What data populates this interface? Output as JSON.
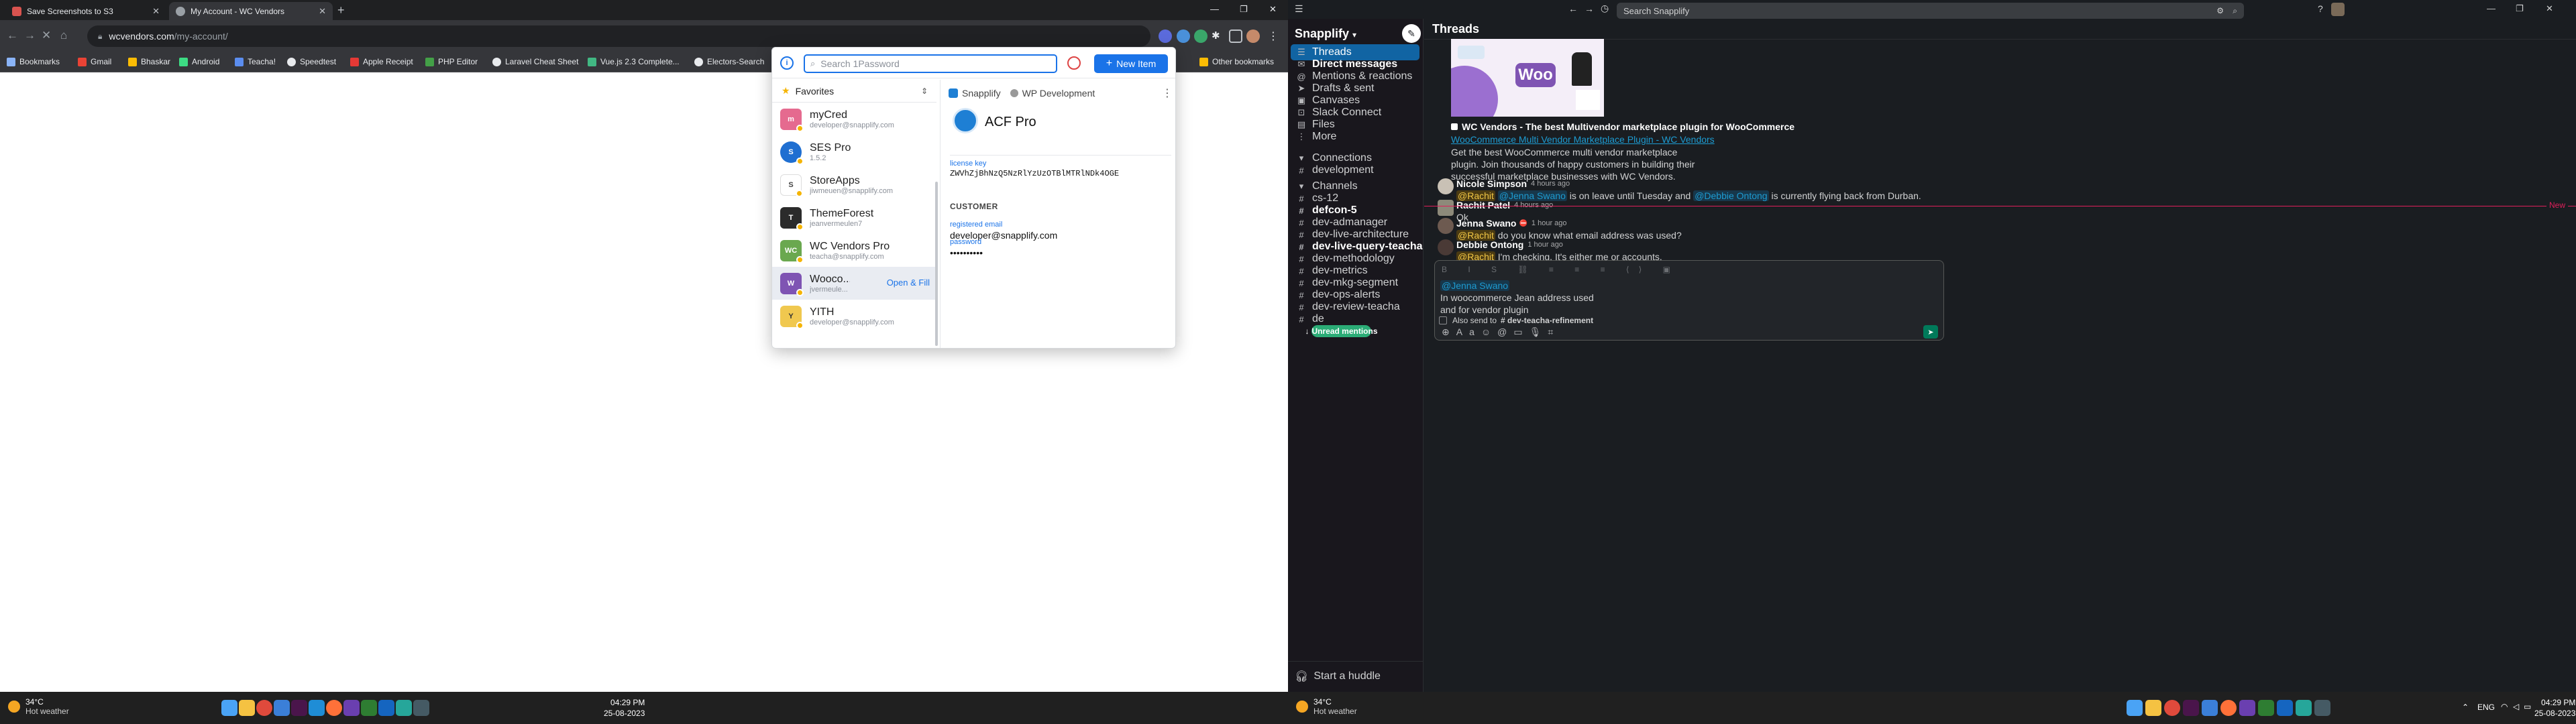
{
  "left": {
    "tabs": [
      {
        "title": "Save Screenshots to S3",
        "color": "#d9534f"
      },
      {
        "title": "My Account - WC Vendors",
        "color": "#9aa0a6"
      }
    ],
    "address": {
      "host": "wcvendors.com",
      "path": "/my-account/"
    },
    "bookmarks": [
      {
        "label": "Bookmarks",
        "color": "#8ab4f8"
      },
      {
        "label": "Gmail",
        "color": "#ea4335"
      },
      {
        "label": "Bhaskar",
        "color": "#fbbc04"
      },
      {
        "label": "Android",
        "color": "#3ddc84"
      },
      {
        "label": "Teacha!",
        "color": "#5b8def"
      },
      {
        "label": "Speedtest",
        "color": "#e8eaed"
      },
      {
        "label": "Apple Receipt",
        "color": "#e53935"
      },
      {
        "label": "PHP Editor",
        "color": "#43a047"
      },
      {
        "label": "Laravel Cheat Sheet",
        "color": "#e8eaed"
      },
      {
        "label": "Vue.js 2.3 Complete...",
        "color": "#41b883"
      },
      {
        "label": "Electors-Search",
        "color": "#e8eaed"
      }
    ],
    "other_bookmarks": "Other bookmarks",
    "onepassword": {
      "search_placeholder": "Search 1Password",
      "new_item": "New Item",
      "favorites_label": "Favorites",
      "items": [
        {
          "name": "myCred",
          "sub": "developer@snapplify.com",
          "color": "#e56a8f",
          "abbr": "m"
        },
        {
          "name": "SES Pro",
          "sub": "1.5.2",
          "color": "#1f6fd1",
          "abbr": "S"
        },
        {
          "name": "StoreApps",
          "sub": "jiwmeuen@snapplify.com",
          "color": "#ffffff",
          "abbr": "S"
        },
        {
          "name": "ThemeForest",
          "sub": "jeanvermeulen7",
          "color": "#2b2b2b",
          "abbr": "T"
        },
        {
          "name": "WC Vendors Pro",
          "sub": "teacha@snapplify.com",
          "color": "#6aa84f",
          "abbr": "WC"
        },
        {
          "name": "Wooco...",
          "sub": "jvermeule...",
          "color": "#7f54b3",
          "abbr": "W"
        },
        {
          "name": "YITH",
          "sub": "developer@snapplify.com",
          "color": "#f0c84f",
          "abbr": "Y"
        }
      ],
      "open_fill": "Open & Fill",
      "vault": "Snapplify",
      "vault2": "WP Development",
      "detail_title": "ACF Pro",
      "license_label": "license key",
      "license_value": "ZWVhZjBhNzQ5NzRlYzUzOTBlMTRlNDk4OGE",
      "customer_label": "CUSTOMER",
      "email_label": "registered email",
      "email_value": "developer@snapplify.com",
      "password_label": "password",
      "password_value": "••••••••••"
    },
    "taskbar": {
      "temp": "34°C",
      "weather": "Hot weather",
      "time": "04:29 PM",
      "date": "25-08-2023"
    }
  },
  "right": {
    "search_placeholder": "Search Snapplify",
    "workspace": "Snapplify",
    "channel_title": "Threads",
    "nav": [
      {
        "label": "Threads",
        "icon": "threads-icon"
      },
      {
        "label": "Direct messages",
        "icon": "dm-icon"
      },
      {
        "label": "Mentions & reactions",
        "icon": "mention-icon"
      },
      {
        "label": "Drafts & sent",
        "icon": "drafts-icon"
      },
      {
        "label": "Canvases",
        "icon": "canvas-icon"
      },
      {
        "label": "Slack Connect",
        "icon": "connect-icon"
      },
      {
        "label": "Files",
        "icon": "files-icon"
      },
      {
        "label": "More",
        "icon": "more-icon"
      }
    ],
    "connections_label": "Connections",
    "connections": [
      "development"
    ],
    "channels_label": "Channels",
    "channels": [
      {
        "name": "cs-12",
        "bold": false
      },
      {
        "name": "defcon-5",
        "bold": true
      },
      {
        "name": "dev-admanager",
        "bold": false
      },
      {
        "name": "dev-live-architecture",
        "bold": false
      },
      {
        "name": "dev-live-query-teacha",
        "bold": true
      },
      {
        "name": "dev-methodology",
        "bold": false
      },
      {
        "name": "dev-metrics",
        "bold": false
      },
      {
        "name": "dev-mkg-segment",
        "bold": false
      },
      {
        "name": "dev-ops-alerts",
        "bold": false
      },
      {
        "name": "dev-review-teacha",
        "bold": false
      },
      {
        "name": "de",
        "bold": false
      }
    ],
    "unread_mentions": "Unread mentions",
    "huddle": "Start a huddle",
    "unfurl": {
      "woo_logo": "Woo",
      "title": "WC Vendors - The best Multivendor marketplace plugin for WooCommerce",
      "link": "WooCommerce Multi Vendor Marketplace Plugin - WC Vendors",
      "desc": "Get the best WooCommerce multi vendor marketplace plugin. Join thousands of happy customers in building their successful marketplace businesses with WC Vendors."
    },
    "messages": [
      {
        "author": "Nicole Simpson",
        "time": "4 hours ago",
        "parts": [
          [
            "m",
            "@Rachit"
          ],
          [
            "t",
            " "
          ],
          [
            "m2",
            "@Jenna Swano"
          ],
          [
            "t",
            " is on leave until Tuesday and "
          ],
          [
            "m2",
            "@Debbie Ontong"
          ],
          [
            "t",
            " is currently flying back from Durban."
          ]
        ]
      },
      {
        "author": "Rachit Patel",
        "time": "4 hours ago",
        "parts": [
          [
            "t",
            "Ok"
          ]
        ]
      },
      {
        "author": "Jenna Swano",
        "time": "1 hour ago",
        "parts": [
          [
            "m",
            "@Rachit"
          ],
          [
            "t",
            " do you know what email address was used?"
          ]
        ]
      },
      {
        "author": "Debbie Ontong",
        "time": "1 hour ago",
        "parts": [
          [
            "m",
            "@Rachit"
          ],
          [
            "t",
            " I'm checking. It's either me or accounts."
          ]
        ]
      }
    ],
    "new_label": "New",
    "composer": {
      "mention": "@Jenna Swano",
      "line1": "In woocommerce Jean address used",
      "line2": "and for vendor plugin",
      "also_send": "Also send to",
      "also_channel": "# dev-teacha-refinement"
    },
    "taskbar": {
      "temp": "34°C",
      "weather": "Hot weather",
      "lang": "ENG",
      "time": "04:29 PM",
      "date": "25-08-2023"
    }
  }
}
